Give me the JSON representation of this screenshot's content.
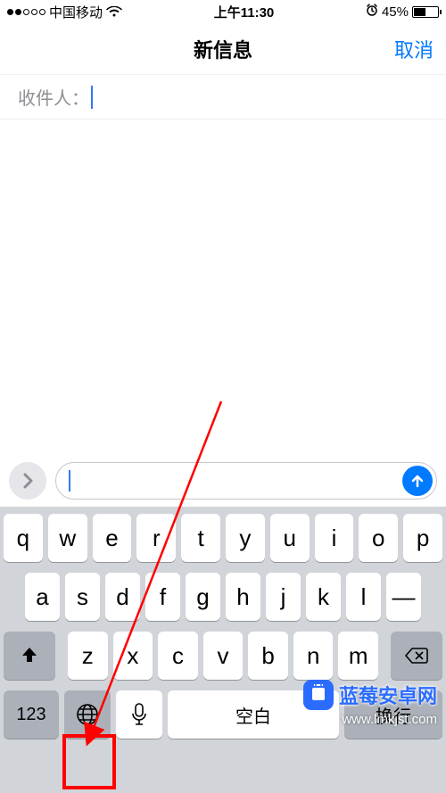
{
  "status": {
    "carrier": "中国移动",
    "time": "上午11:30",
    "battery_pct": "45%"
  },
  "nav": {
    "title": "新信息",
    "cancel": "取消"
  },
  "recipient": {
    "label": "收件人："
  },
  "compose": {
    "placeholder": ""
  },
  "keyboard": {
    "row1": [
      "q",
      "w",
      "e",
      "r",
      "t",
      "y",
      "u",
      "i",
      "o",
      "p"
    ],
    "row2": [
      "a",
      "s",
      "d",
      "f",
      "g",
      "h",
      "j",
      "k",
      "l",
      "—"
    ],
    "row3": [
      "z",
      "x",
      "c",
      "v",
      "b",
      "n",
      "m"
    ],
    "numbers_label": "123",
    "space_label": "空白",
    "return_label": "换行"
  },
  "watermark": {
    "title": "蓝莓安卓网",
    "url": "www.lmkjst.com"
  }
}
